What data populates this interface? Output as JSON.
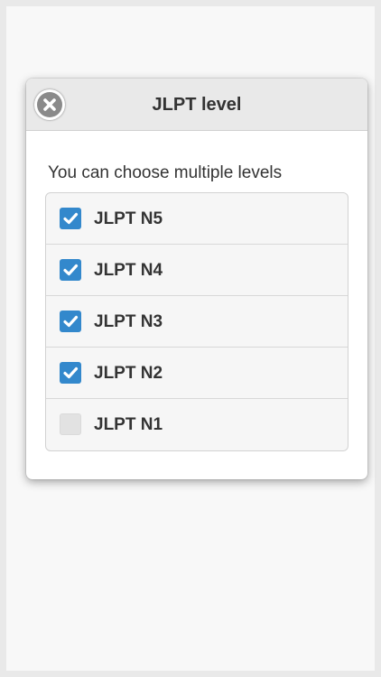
{
  "dialog": {
    "title": "JLPT level",
    "subtitle": "You can choose multiple levels",
    "close_icon": "close-circle-icon"
  },
  "levels": [
    {
      "label": "JLPT N5",
      "checked": true
    },
    {
      "label": "JLPT N4",
      "checked": true
    },
    {
      "label": "JLPT N3",
      "checked": true
    },
    {
      "label": "JLPT N2",
      "checked": true
    },
    {
      "label": "JLPT N1",
      "checked": false
    }
  ],
  "colors": {
    "accent": "#3388cc",
    "header_background": "#e9e9e9",
    "text": "#333333"
  }
}
